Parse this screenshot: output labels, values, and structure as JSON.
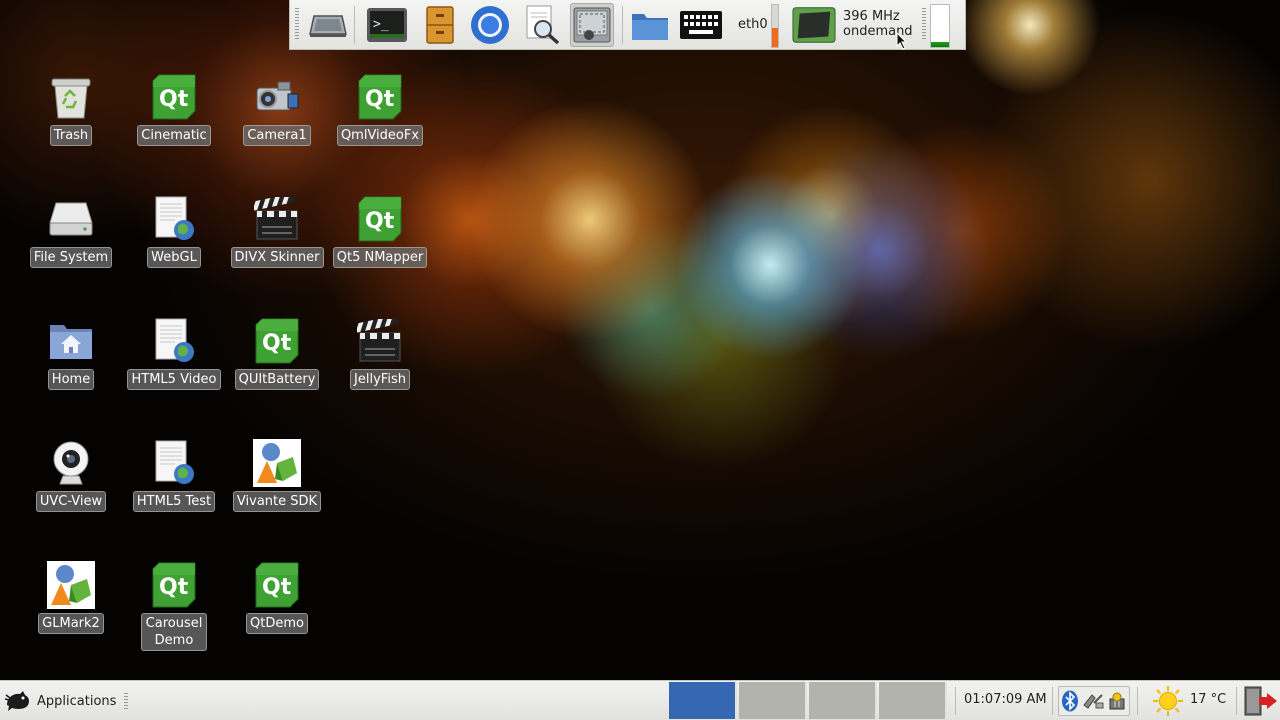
{
  "top_panel": {
    "launchers": [
      {
        "name": "monitor-launcher",
        "icon": "monitor-icon"
      },
      {
        "name": "terminal-launcher",
        "icon": "terminal-icon"
      },
      {
        "name": "file-cabinet-launcher",
        "icon": "cabinet-icon"
      },
      {
        "name": "chromium-launcher",
        "icon": "chromium-icon"
      },
      {
        "name": "search-launcher",
        "icon": "search-icon"
      },
      {
        "name": "screenshot-launcher",
        "icon": "screenshot-icon"
      },
      {
        "name": "folder-launcher",
        "icon": "folder-icon"
      },
      {
        "name": "keyboard-launcher",
        "icon": "keyboard-icon"
      }
    ],
    "network": {
      "interface": "eth0",
      "load_fraction": 0.45
    },
    "cpu": {
      "frequency": "396 MHz",
      "governor": "ondemand"
    },
    "memory": {
      "usage_fraction": 0.12
    }
  },
  "desktop": {
    "icons": [
      {
        "label": "Trash",
        "icon": "trash-icon"
      },
      {
        "label": "Cinematic",
        "icon": "qt-icon"
      },
      {
        "label": "Camera1",
        "icon": "camera-icon"
      },
      {
        "label": "QmlVideoFx",
        "icon": "qt-icon"
      },
      {
        "label": "File System",
        "icon": "drive-icon"
      },
      {
        "label": "WebGL",
        "icon": "html-doc-icon"
      },
      {
        "label": "DIVX Skinner",
        "icon": "clapperboard-icon"
      },
      {
        "label": "Qt5 NMapper",
        "icon": "qt-icon"
      },
      {
        "label": "Home",
        "icon": "home-folder-icon"
      },
      {
        "label": "HTML5 Video",
        "icon": "html-doc-icon"
      },
      {
        "label": "QUItBattery",
        "icon": "qt-icon"
      },
      {
        "label": "JellyFish",
        "icon": "clapperboard-icon"
      },
      {
        "label": "UVC-View",
        "icon": "webcam-icon"
      },
      {
        "label": "HTML5 Test",
        "icon": "html-doc-icon"
      },
      {
        "label": "Vivante SDK",
        "icon": "shapes-icon"
      },
      {
        "label": "GLMark2",
        "icon": "shapes-icon"
      },
      {
        "label": "Carousel Demo",
        "icon": "qt-icon"
      },
      {
        "label": "QtDemo",
        "icon": "qt-icon"
      }
    ]
  },
  "bottom_panel": {
    "applications_label": "Applications",
    "workspaces": [
      {
        "active": true
      },
      {
        "active": false
      },
      {
        "active": false
      },
      {
        "active": false
      }
    ],
    "clock": "01:07:09 AM",
    "tray_icons": [
      "bluetooth-icon",
      "network-icon",
      "updates-icon"
    ],
    "weather": {
      "temperature": "17 °C",
      "icon": "sun-icon"
    },
    "logout_icon": "logout-icon",
    "colors": {
      "workspace_active": "#3567b3",
      "workspace_inactive": "#b3b3ae"
    }
  }
}
